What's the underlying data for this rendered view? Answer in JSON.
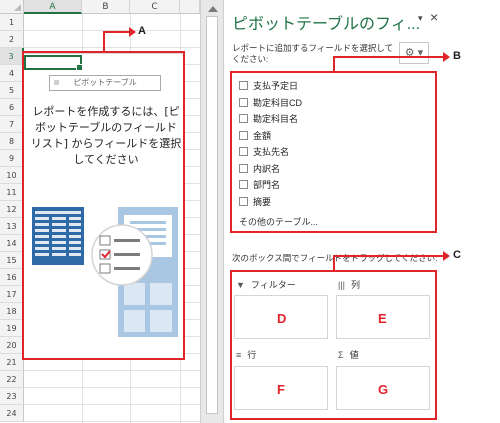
{
  "sheet": {
    "columns": [
      "A",
      "B",
      "C"
    ],
    "rows": [
      "1",
      "2",
      "3",
      "4",
      "5",
      "6",
      "7",
      "8",
      "9",
      "10",
      "11",
      "12",
      "13",
      "14",
      "15",
      "16",
      "17",
      "18",
      "19",
      "20",
      "21",
      "22",
      "23",
      "24"
    ],
    "selected_col": "A",
    "selected_row": "3"
  },
  "pivot_placeholder": {
    "button_label": "ピボットテーブル",
    "message": "レポートを作成するには、[ピボットテーブルのフィールド リスト] からフィールドを選択してください"
  },
  "pane": {
    "title": "ピボットテーブルのフィ...",
    "close_label": "×",
    "dropdown_label": "▾",
    "hint": "レポートに追加するフィールドを選択してください:",
    "gear_label": "⚙ ▾",
    "fields": [
      "支払予定日",
      "勘定科目CD",
      "勘定科目名",
      "金額",
      "支払先名",
      "内訳名",
      "部門名",
      "摘要"
    ],
    "other_tables": "その他のテーブル...",
    "drag_hint": "次のボックス間でフィールドをドラッグしてください:",
    "areas": {
      "filter": {
        "label": "フィルター",
        "icon": "filter-icon",
        "glyph": "▼"
      },
      "columns": {
        "label": "列",
        "icon": "columns-icon",
        "glyph": "|||"
      },
      "rows": {
        "label": "行",
        "icon": "rows-icon",
        "glyph": "≡"
      },
      "values": {
        "label": "値",
        "icon": "sigma-icon",
        "glyph": "Σ"
      }
    }
  },
  "callouts": {
    "a": "A",
    "b": "B",
    "c": "C",
    "d": "D",
    "e": "E",
    "f": "F",
    "g": "G"
  },
  "colors": {
    "accent": "#217346",
    "callout_red": "#e0242b"
  }
}
